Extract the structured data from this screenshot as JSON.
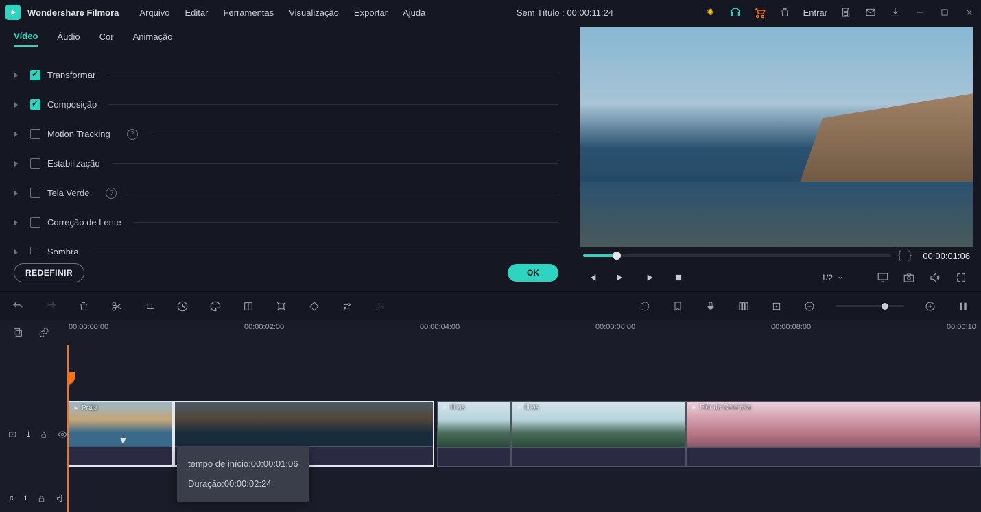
{
  "app": {
    "name": "Wondershare Filmora"
  },
  "menu": {
    "file": "Arquivo",
    "edit": "Editar",
    "tools": "Ferramentas",
    "view": "Visualização",
    "export": "Exportar",
    "help": "Ajuda"
  },
  "title": {
    "project": "Sem Título : 00:00:11:24",
    "login": "Entrar"
  },
  "tabs": {
    "video": "Vídeo",
    "audio": "Áudio",
    "color": "Cor",
    "animation": "Animação"
  },
  "props": {
    "transform": "Transformar",
    "compose": "Composição",
    "motion": "Motion Tracking",
    "stab": "Estabilização",
    "green": "Tela Verde",
    "lens": "Correção de Lente",
    "shadow": "Sombra"
  },
  "buttons": {
    "reset": "REDEFINIR",
    "ok": "OK"
  },
  "preview": {
    "time": "00:00:01:06",
    "page": "1/2"
  },
  "ruler": {
    "t0": "00:00:00:00",
    "t2": "00:00:02:00",
    "t4": "00:00:04:00",
    "t6": "00:00:06:00",
    "t8": "00:00:08:00",
    "t10": "00:00:10"
  },
  "tracks": {
    "video_id": "1",
    "audio_id": "1"
  },
  "clips": {
    "praia": "Praia",
    "ilhas": "Ilhas",
    "flor": "Flor de Cerejeira"
  },
  "tooltip": {
    "start_label": "tempo de início:",
    "start_val": "00:00:01:06",
    "dur_label": "Duração:",
    "dur_val": "00:00:02:24"
  }
}
